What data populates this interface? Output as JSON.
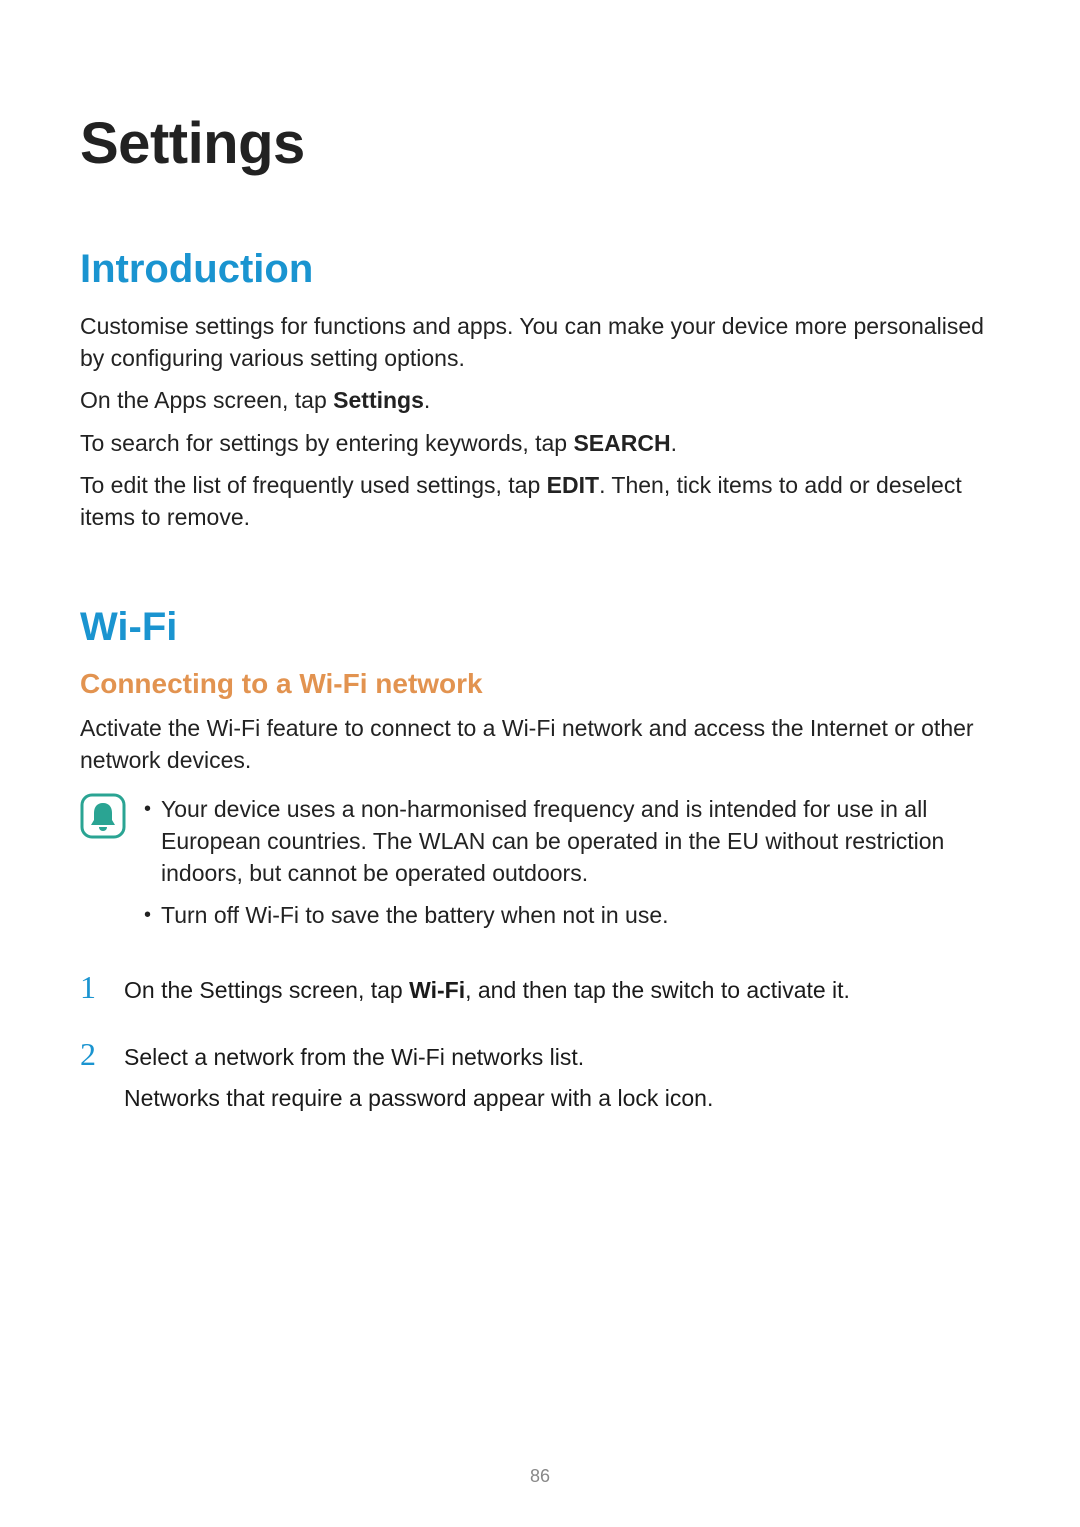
{
  "page_number": "86",
  "title": "Settings",
  "intro": {
    "heading": "Introduction",
    "p1": "Customise settings for functions and apps. You can make your device more personalised by configuring various setting options.",
    "p2_pre": "On the Apps screen, tap ",
    "p2_bold": "Settings",
    "p2_post": ".",
    "p3_pre": "To search for settings by entering keywords, tap ",
    "p3_bold": "SEARCH",
    "p3_post": ".",
    "p4_pre": "To edit the list of frequently used settings, tap ",
    "p4_bold": "EDIT",
    "p4_post": ". Then, tick items to add or deselect items to remove."
  },
  "wifi": {
    "heading": "Wi-Fi",
    "sub": "Connecting to a Wi-Fi network",
    "p1": "Activate the Wi-Fi feature to connect to a Wi-Fi network and access the Internet or other network devices.",
    "note_bullets": [
      "Your device uses a non-harmonised frequency and is intended for use in all European countries. The WLAN can be operated in the EU without restriction indoors, but cannot be operated outdoors.",
      "Turn off Wi-Fi to save the battery when not in use."
    ],
    "steps": {
      "one_pre": "On the Settings screen, tap ",
      "one_bold": "Wi-Fi",
      "one_post": ", and then tap the switch to activate it.",
      "two_a": "Select a network from the Wi-Fi networks list.",
      "two_b": "Networks that require a password appear with a lock icon."
    }
  },
  "labels": {
    "bullet_dot": "•",
    "step1_num": "1",
    "step2_num": "2"
  },
  "icons": {
    "note": "bell-outline-icon"
  }
}
